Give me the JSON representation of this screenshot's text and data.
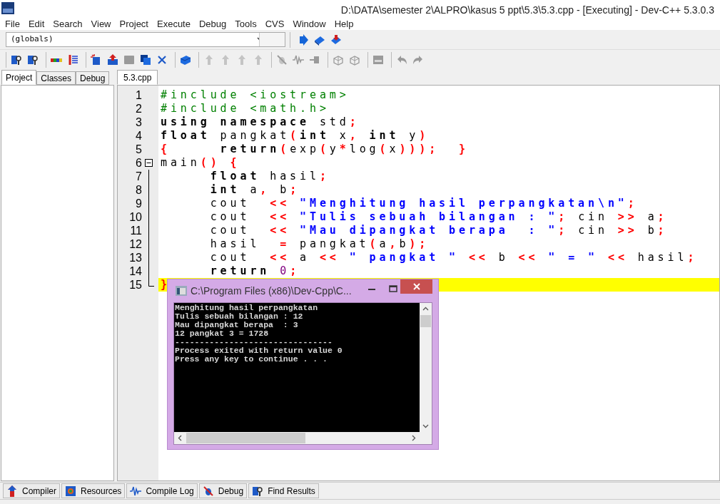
{
  "window": {
    "title": "D:\\DATA\\semester 2\\ALPRO\\kasus 5 ppt\\5.3\\5.3.cpp - [Executing] - Dev-C++ 5.3.0.3"
  },
  "menu": [
    "File",
    "Edit",
    "Search",
    "View",
    "Project",
    "Execute",
    "Debug",
    "Tools",
    "CVS",
    "Window",
    "Help"
  ],
  "toolbar_row_1": {
    "combo": "(globals)",
    "buttons": [
      {
        "disabled": false
      },
      {
        "disabled": false
      },
      {
        "disabled": false
      }
    ]
  },
  "toolbar_row_2": {
    "groups": [
      [
        {
          "disabled": false
        },
        {
          "disabled": false
        }
      ],
      [
        {
          "disabled": false
        },
        {
          "disabled": false
        }
      ],
      [
        {
          "disabled": false
        },
        {
          "disabled": false
        },
        {
          "disabled": true
        },
        {
          "disabled": false
        },
        {
          "disabled": false
        }
      ],
      [
        {
          "disabled": false
        }
      ],
      [
        {
          "disabled": true
        },
        {
          "disabled": true
        },
        {
          "disabled": true
        },
        {
          "disabled": true
        }
      ],
      [
        {
          "disabled": true
        },
        {
          "disabled": true
        },
        {
          "disabled": true
        }
      ],
      [
        {
          "disabled": true
        },
        {
          "disabled": true
        }
      ],
      [
        {
          "disabled": true
        }
      ],
      [
        {
          "disabled": true
        },
        {
          "disabled": true
        }
      ]
    ]
  },
  "side_tabs": [
    {
      "label": "Project",
      "selected": true
    },
    {
      "label": "Classes",
      "selected": false
    },
    {
      "label": "Debug",
      "selected": false
    }
  ],
  "editor_tabs": [
    {
      "label": "5.3.cpp",
      "selected": true
    }
  ],
  "code_lines": [
    {
      "number": "1",
      "tokens": [
        {
          "kind": "pre",
          "text": "#include <iostream>"
        }
      ]
    },
    {
      "number": "2",
      "tokens": [
        {
          "kind": "pre",
          "text": "#include <math.h>"
        }
      ]
    },
    {
      "number": "3",
      "tokens": [
        {
          "kind": "kw",
          "text": "using"
        },
        {
          "kind": "kw",
          "text": " namespace"
        },
        {
          "kind": "id",
          "text": " std"
        },
        {
          "kind": "sym",
          "text": ";"
        }
      ]
    },
    {
      "number": "4",
      "tokens": [
        {
          "kind": "kw",
          "text": "float"
        },
        {
          "kind": "id",
          "text": " pangkat"
        },
        {
          "kind": "sym",
          "text": "("
        },
        {
          "kind": "kw",
          "text": "int"
        },
        {
          "kind": "id",
          "text": " x"
        },
        {
          "kind": "sym",
          "text": ","
        },
        {
          "kind": "kw",
          "text": " int"
        },
        {
          "kind": "id",
          "text": " y"
        },
        {
          "kind": "sym",
          "text": ")"
        }
      ]
    },
    {
      "number": "5",
      "tokens": [
        {
          "kind": "sym",
          "text": "{"
        },
        {
          "kind": "kw",
          "text": "     return"
        },
        {
          "kind": "sym",
          "text": "("
        },
        {
          "kind": "id",
          "text": "exp"
        },
        {
          "kind": "sym",
          "text": "("
        },
        {
          "kind": "id",
          "text": "y"
        },
        {
          "kind": "sym",
          "text": "*"
        },
        {
          "kind": "id",
          "text": "log"
        },
        {
          "kind": "sym",
          "text": "("
        },
        {
          "kind": "id",
          "text": "x"
        },
        {
          "kind": "sym",
          "text": ")));  }"
        }
      ]
    },
    {
      "number": "6",
      "fold_open": true,
      "tokens": [
        {
          "kind": "id",
          "text": "main"
        },
        {
          "kind": "sym",
          "text": "()"
        },
        {
          "kind": "sym",
          "text": " {"
        }
      ]
    },
    {
      "number": "7",
      "tokens": [
        {
          "kind": "kw",
          "text": "     float"
        },
        {
          "kind": "id",
          "text": " hasil"
        },
        {
          "kind": "sym",
          "text": ";"
        }
      ]
    },
    {
      "number": "8",
      "tokens": [
        {
          "kind": "kw",
          "text": "     int"
        },
        {
          "kind": "id",
          "text": " a"
        },
        {
          "kind": "sym",
          "text": ","
        },
        {
          "kind": "id",
          "text": " b"
        },
        {
          "kind": "sym",
          "text": ";"
        }
      ]
    },
    {
      "number": "9",
      "tokens": [
        {
          "kind": "id",
          "text": "     cout"
        },
        {
          "kind": "sym",
          "text": "  <<"
        },
        {
          "kind": "str",
          "text": " \"Menghitung hasil perpangkatan\\n\""
        },
        {
          "kind": "sym",
          "text": ";"
        }
      ]
    },
    {
      "number": "10",
      "tokens": [
        {
          "kind": "id",
          "text": "     cout"
        },
        {
          "kind": "sym",
          "text": "  <<"
        },
        {
          "kind": "str",
          "text": " \"Tulis sebuah bilangan : \""
        },
        {
          "kind": "sym",
          "text": ";"
        },
        {
          "kind": "id",
          "text": " cin"
        },
        {
          "kind": "sym",
          "text": " >>"
        },
        {
          "kind": "id",
          "text": " a"
        },
        {
          "kind": "sym",
          "text": ";"
        }
      ]
    },
    {
      "number": "11",
      "tokens": [
        {
          "kind": "id",
          "text": "     cout"
        },
        {
          "kind": "sym",
          "text": "  <<"
        },
        {
          "kind": "str",
          "text": " \"Mau dipangkat berapa  : \""
        },
        {
          "kind": "sym",
          "text": ";"
        },
        {
          "kind": "id",
          "text": " cin"
        },
        {
          "kind": "sym",
          "text": " >>"
        },
        {
          "kind": "id",
          "text": " b"
        },
        {
          "kind": "sym",
          "text": ";"
        }
      ]
    },
    {
      "number": "12",
      "tokens": [
        {
          "kind": "id",
          "text": "     hasil"
        },
        {
          "kind": "sym",
          "text": "  ="
        },
        {
          "kind": "id",
          "text": " pangkat"
        },
        {
          "kind": "sym",
          "text": "("
        },
        {
          "kind": "id",
          "text": "a"
        },
        {
          "kind": "sym",
          "text": ","
        },
        {
          "kind": "id",
          "text": "b"
        },
        {
          "kind": "sym",
          "text": ");"
        }
      ]
    },
    {
      "number": "13",
      "tokens": [
        {
          "kind": "id",
          "text": "     cout"
        },
        {
          "kind": "sym",
          "text": "  <<"
        },
        {
          "kind": "id",
          "text": " a"
        },
        {
          "kind": "sym",
          "text": " <<"
        },
        {
          "kind": "str",
          "text": " \" pangkat \""
        },
        {
          "kind": "sym",
          "text": " <<"
        },
        {
          "kind": "id",
          "text": " b"
        },
        {
          "kind": "sym",
          "text": " <<"
        },
        {
          "kind": "str",
          "text": " \" = \""
        },
        {
          "kind": "sym",
          "text": " <<"
        },
        {
          "kind": "id",
          "text": " hasil"
        },
        {
          "kind": "sym",
          "text": ";"
        }
      ]
    },
    {
      "number": "14",
      "tokens": [
        {
          "kind": "kw",
          "text": "     return"
        },
        {
          "kind": "num",
          "text": " 0"
        },
        {
          "kind": "sym",
          "text": ";"
        }
      ]
    },
    {
      "number": "15",
      "fold_end": true,
      "highlighted": true,
      "tokens": [
        {
          "kind": "sym",
          "text": "}"
        }
      ]
    }
  ],
  "console": {
    "title": "C:\\Program Files (x86)\\Dev-Cpp\\C...",
    "lines": [
      "Menghitung hasil perpangkatan",
      "Tulis sebuah bilangan : 12",
      "Mau dipangkat berapa  : 3",
      "12 pangkat 3 = 1728",
      "--------------------------------",
      "Process exited with return value 0",
      "Press any key to continue . . ."
    ]
  },
  "bottom_tabs": [
    {
      "label": "Compiler",
      "selected": false
    },
    {
      "label": "Resources",
      "selected": false
    },
    {
      "label": "Compile Log",
      "selected": false
    },
    {
      "label": "Debug",
      "selected": false
    },
    {
      "label": "Find Results",
      "selected": false
    }
  ]
}
